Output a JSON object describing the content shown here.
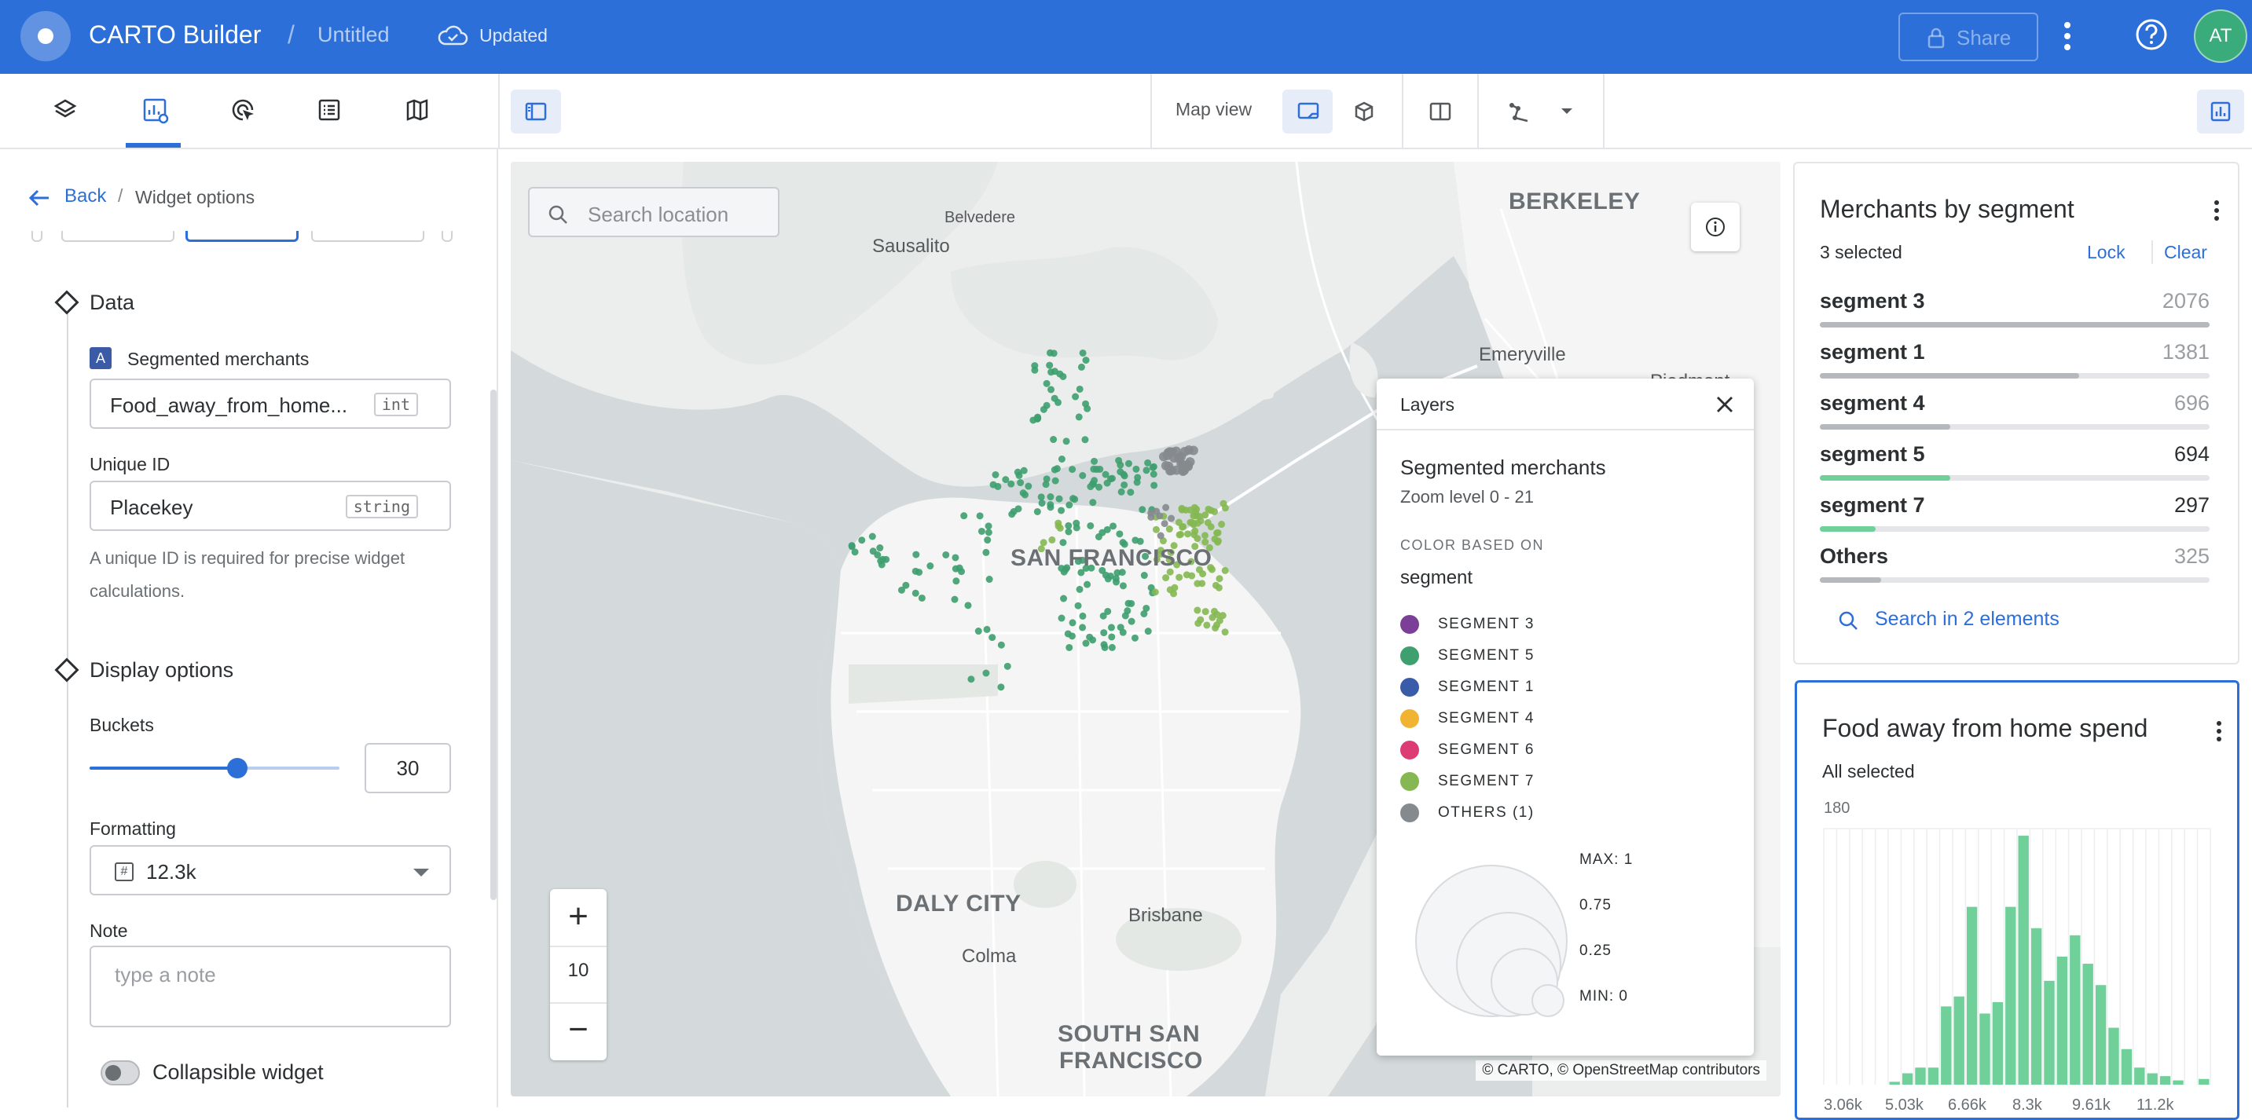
{
  "topbar": {
    "app_title": "CARTO Builder",
    "separator": "/",
    "map_name": "Untitled",
    "status": "Updated",
    "share_label": "Share",
    "avatar_initials": "AT",
    "brand_color": "#2c6fd9"
  },
  "toolbar": {
    "tools": [
      "layers-icon",
      "widgets-icon",
      "interactions-icon",
      "legend-icon",
      "basemap-icon"
    ],
    "map_view_label": "Map view"
  },
  "sidebar": {
    "back_label": "Back",
    "breadcrumb_sep": "/",
    "page_title": "Widget options",
    "data_section": "Data",
    "source_badge": "A",
    "source_name": "Segmented merchants",
    "field_value": "Food_away_from_home...",
    "field_type": "int",
    "unique_id_label": "Unique ID",
    "unique_id_value": "Placekey",
    "unique_id_type": "string",
    "unique_id_help": "A unique ID is required for precise widget calculations.",
    "display_section": "Display options",
    "buckets_label": "Buckets",
    "buckets_value": "30",
    "buckets_slider_fraction": 0.59,
    "formatting_label": "Formatting",
    "formatting_icon": "#",
    "formatting_value": "12.3k",
    "note_label": "Note",
    "note_placeholder": "type a note",
    "collapsible_label": "Collapsible widget"
  },
  "map": {
    "search_placeholder": "Search location",
    "zoom_level": "10",
    "zoom_in": "+",
    "zoom_out": "−",
    "attribution": "© CARTO, © OpenStreetMap contributors",
    "places": {
      "berkeley": "BERKELEY",
      "belvedere": "Belvedere",
      "sausalito": "Sausalito",
      "emeryville": "Emeryville",
      "piedmont": "Piedmont",
      "sf": "SAN FRANCISCO",
      "daly_city": "DALY CITY",
      "brisbane": "Brisbane",
      "colma": "Colma",
      "south_sf_1": "SOUTH SAN",
      "south_sf_2": "FRANCISCO"
    }
  },
  "layers_panel": {
    "title": "Layers",
    "layer_name": "Segmented merchants",
    "zoom_range": "Zoom level 0 - 21",
    "color_based_on_label": "COLOR BASED ON",
    "color_field": "segment",
    "legend": [
      {
        "label": "SEGMENT 3",
        "color": "#7b3f98"
      },
      {
        "label": "SEGMENT 5",
        "color": "#3e9f6f"
      },
      {
        "label": "SEGMENT 1",
        "color": "#3a5ca8"
      },
      {
        "label": "SEGMENT 4",
        "color": "#f0b432"
      },
      {
        "label": "SEGMENT 6",
        "color": "#dc3b74"
      },
      {
        "label": "SEGMENT 7",
        "color": "#85b852"
      },
      {
        "label": "OTHERS (1)",
        "color": "#858a8e"
      }
    ],
    "size_legend": [
      "MAX: 1",
      "0.75",
      "0.25",
      "MIN: 0"
    ]
  },
  "widget_categories": {
    "title": "Merchants by segment",
    "selected_text": "3 selected",
    "lock_label": "Lock",
    "clear_label": "Clear",
    "search_label": "Search in 2 elements",
    "rows": [
      {
        "name": "segment 3",
        "value": "2076",
        "fraction": 1.0,
        "selected": false
      },
      {
        "name": "segment 1",
        "value": "1381",
        "fraction": 0.665,
        "selected": false
      },
      {
        "name": "segment 4",
        "value": "696",
        "fraction": 0.335,
        "selected": false
      },
      {
        "name": "segment 5",
        "value": "694",
        "fraction": 0.334,
        "selected": true
      },
      {
        "name": "segment 7",
        "value": "297",
        "fraction": 0.143,
        "selected": true
      },
      {
        "name": "Others",
        "value": "325",
        "fraction": 0.157,
        "selected": false
      }
    ],
    "selected_color": "#6fd09a",
    "unselected_color": "#b5b8bc"
  },
  "widget_histogram": {
    "title": "Food away from home spend",
    "selected_text": "All selected",
    "bar_color": "#6fd09a"
  },
  "chart_data": {
    "type": "bar",
    "title": "Food away from home spend",
    "ylim": [
      0,
      180
    ],
    "y_tick_label": "180",
    "x_tick_labels": [
      "3.06k",
      "5.03k",
      "6.66k",
      "8.3k",
      "9.61k",
      "11.2k"
    ],
    "values": [
      0,
      0,
      0,
      0,
      0,
      2,
      8,
      12,
      12,
      55,
      62,
      125,
      50,
      58,
      125,
      175,
      110,
      73,
      90,
      105,
      85,
      70,
      40,
      25,
      12,
      8,
      6,
      3,
      0,
      4
    ]
  }
}
